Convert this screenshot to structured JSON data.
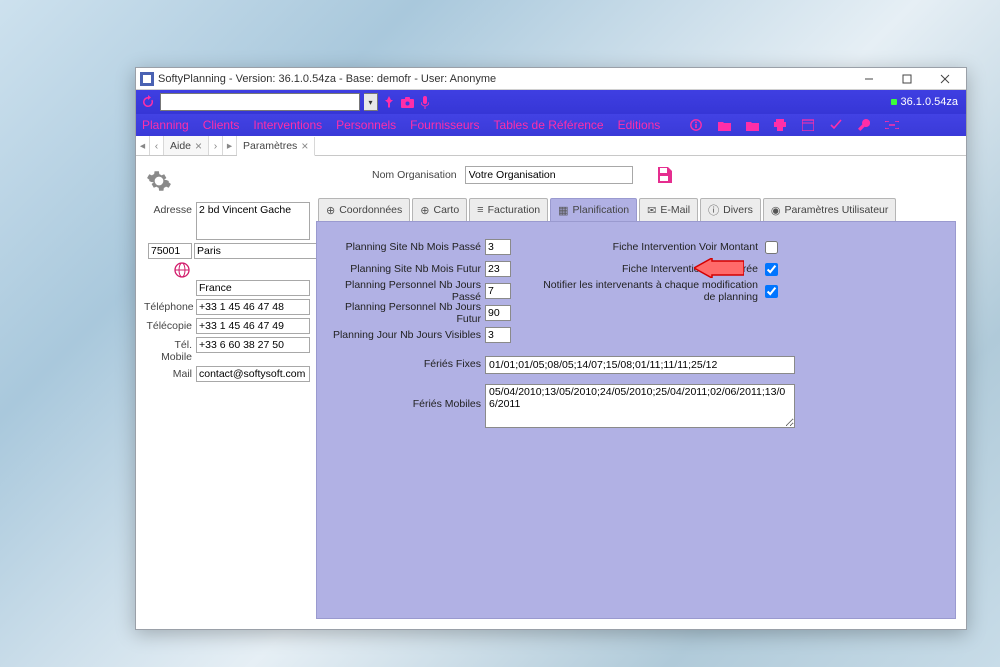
{
  "window": {
    "title": "SoftyPlanning - Version: 36.1.0.54za - Base: demofr - User: Anonyme",
    "version_badge": "36.1.0.54za"
  },
  "menus": [
    "Planning",
    "Clients",
    "Interventions",
    "Personnels",
    "Fournisseurs",
    "Tables de Référence",
    "Editions"
  ],
  "doc_tabs": [
    {
      "label": "Aide"
    },
    {
      "label": "Paramètres"
    }
  ],
  "organisation": {
    "label": "Nom Organisation",
    "value": "Votre Organisation"
  },
  "address": {
    "adresse_label": "Adresse",
    "adresse_value": "2 bd Vincent Gache",
    "postal": "75001",
    "city": "Paris",
    "country": "France",
    "telephone_label": "Téléphone",
    "telephone_value": "+33 1 45 46 47 48",
    "telecopie_label": "Télécopie",
    "telecopie_value": "+33 1 45 46 47 49",
    "mobile_label": "Tél. Mobile",
    "mobile_value": "+33 6 60 38 27 50",
    "mail_label": "Mail",
    "mail_value": "contact@softysoft.com"
  },
  "inner_tabs": [
    "Coordonnées",
    "Carto",
    "Facturation",
    "Planification",
    "E-Mail",
    "Divers",
    "Paramètres Utilisateur"
  ],
  "planning": {
    "site_mois_passe_label": "Planning Site Nb Mois Passé",
    "site_mois_passe_value": "3",
    "site_mois_futur_label": "Planning Site Nb Mois Futur",
    "site_mois_futur_value": "23",
    "pers_jours_passe_label": "Planning Personnel Nb Jours Passé",
    "pers_jours_passe_value": "7",
    "pers_jours_futur_label": "Planning Personnel Nb Jours Futur",
    "pers_jours_futur_value": "90",
    "jour_visibles_label": "Planning Jour Nb Jours Visibles",
    "jour_visibles_value": "3",
    "fiche_montant_label": "Fiche Intervention Voir Montant",
    "fiche_montant_checked": false,
    "fiche_duree_label": "Fiche Intervention Voir Durée",
    "fiche_duree_checked": true,
    "notifier_label": "Notifier les intervenants à chaque modification de planning",
    "notifier_checked": true,
    "feries_fixes_label": "Fériés Fixes",
    "feries_fixes_value": "01/01;01/05;08/05;14/07;15/08;01/11;11/11;25/12",
    "feries_mobiles_label": "Fériés Mobiles",
    "feries_mobiles_value": "05/04/2010;13/05/2010;24/05/2010;25/04/2011;02/06/2011;13/06/2011"
  }
}
